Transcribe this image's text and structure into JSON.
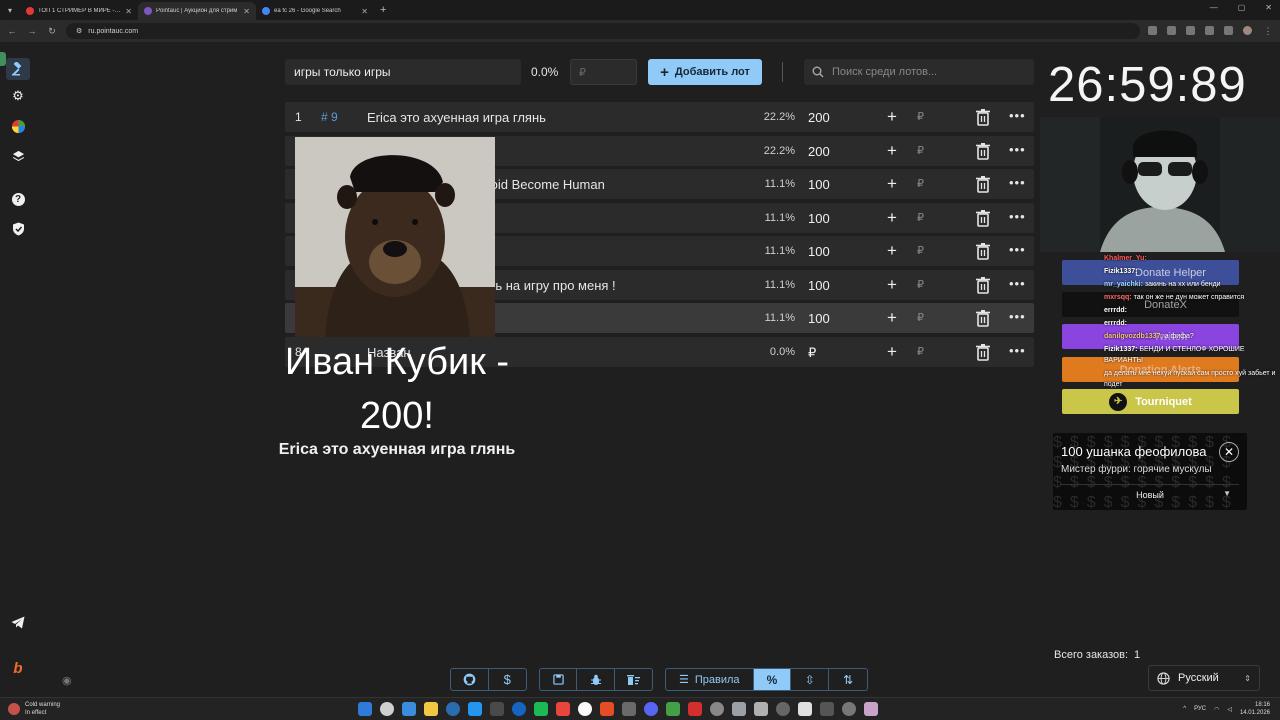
{
  "browser": {
    "tabs": [
      {
        "title": "ТОП 1 СТРИМЕР В МИРЕ - You",
        "favicon_color": "#e53935"
      },
      {
        "title": "Pointauc | Аукцион для стрим",
        "favicon_color": "#7e57c2"
      },
      {
        "title": "ea fc 26 - Google Search",
        "favicon_color": "#4285f4"
      }
    ],
    "address": "ru.pointauc.com"
  },
  "controls": {
    "lot_name_value": "игры только игры",
    "percent": "0.0%",
    "amount_placeholder": "₽",
    "add_lot_label": "Добавить лот",
    "search_placeholder": "Поиск среди лотов..."
  },
  "lots": [
    {
      "index": "1",
      "tag": "# 9",
      "name": "Erica это ахуенная игра глянь",
      "percent": "22.2%",
      "amount": "200"
    },
    {
      "index": "",
      "tag": "",
      "name": "",
      "percent": "22.2%",
      "amount": "200"
    },
    {
      "index": "",
      "tag": "",
      "name": "понял без слов, Detroid Become Human",
      "percent": "11.1%",
      "amount": "100"
    },
    {
      "index": "",
      "tag": "",
      "name": "",
      "percent": "11.1%",
      "amount": "100"
    },
    {
      "index": "",
      "tag": "",
      "name": "я игра",
      "percent": "11.1%",
      "amount": "100"
    },
    {
      "index": "",
      "tag": "",
      "name": "дились! Хочу закинуть на игру про меня !",
      "percent": "11.1%",
      "amount": "100"
    },
    {
      "index": "",
      "tag": "",
      "name": "",
      "percent": "11.1%",
      "amount": "100"
    },
    {
      "index": "8",
      "tag": "",
      "name": "Назван",
      "percent": "0.0%",
      "amount": "₽"
    }
  ],
  "currency": "₽",
  "winner": {
    "name": "Иван Кубик - 200!",
    "lot": "Erica это ахуенная игра глянь"
  },
  "timer": "26:59:89",
  "integrations": {
    "donate_helper": "Donate Helper",
    "donatex": "DonateX",
    "twitch": "Twitch",
    "donation_alerts": "Donation Alerts",
    "tourniquet": "Tourniquet"
  },
  "chat": [
    {
      "nick": "Khalmer_Yu:",
      "text": "",
      "color": "#ff5a5a"
    },
    {
      "nick": "Fizik1337:",
      "text": "",
      "color": "#ffffff"
    },
    {
      "nick": "mr_yaichki:",
      "text": "закинь на хх или бенди",
      "color": "#9fd4ff"
    },
    {
      "nick": "mxrsqq:",
      "text": "так он же не дун может справится",
      "color": "#ff6b6b"
    },
    {
      "nick": "errrdd:",
      "text": "",
      "color": "#ffffff"
    },
    {
      "nick": "errrdd:",
      "text": "",
      "color": "#ffffff"
    },
    {
      "nick": "danilgvozdb1337:",
      "text": "а фифа?",
      "color": "#f0c27b"
    },
    {
      "nick": "Fizik1337:",
      "text": "БЕНДИ И СТЕНЛОФ ХОРОШИЕ ВАРИАНТЫ",
      "color": "#ffffff"
    },
    {
      "nick": "",
      "text": "да делать мне нехуй пускай сам просто хуй забьет и подет",
      "color": "#ffffff"
    }
  ],
  "donation": {
    "title": "100 ушанка феофилова",
    "message": "Мистер фурри: горячие мускулы",
    "status": "Новый"
  },
  "orders": {
    "label": "Всего заказов:",
    "count": "1"
  },
  "language": "Русский",
  "toolbar": {
    "rules_label": "Правила"
  },
  "taskbar": {
    "weather_title": "Cold warning",
    "weather_sub": "In effect",
    "lang": "РУС",
    "time": "18:16",
    "date": "14.01.2026"
  }
}
